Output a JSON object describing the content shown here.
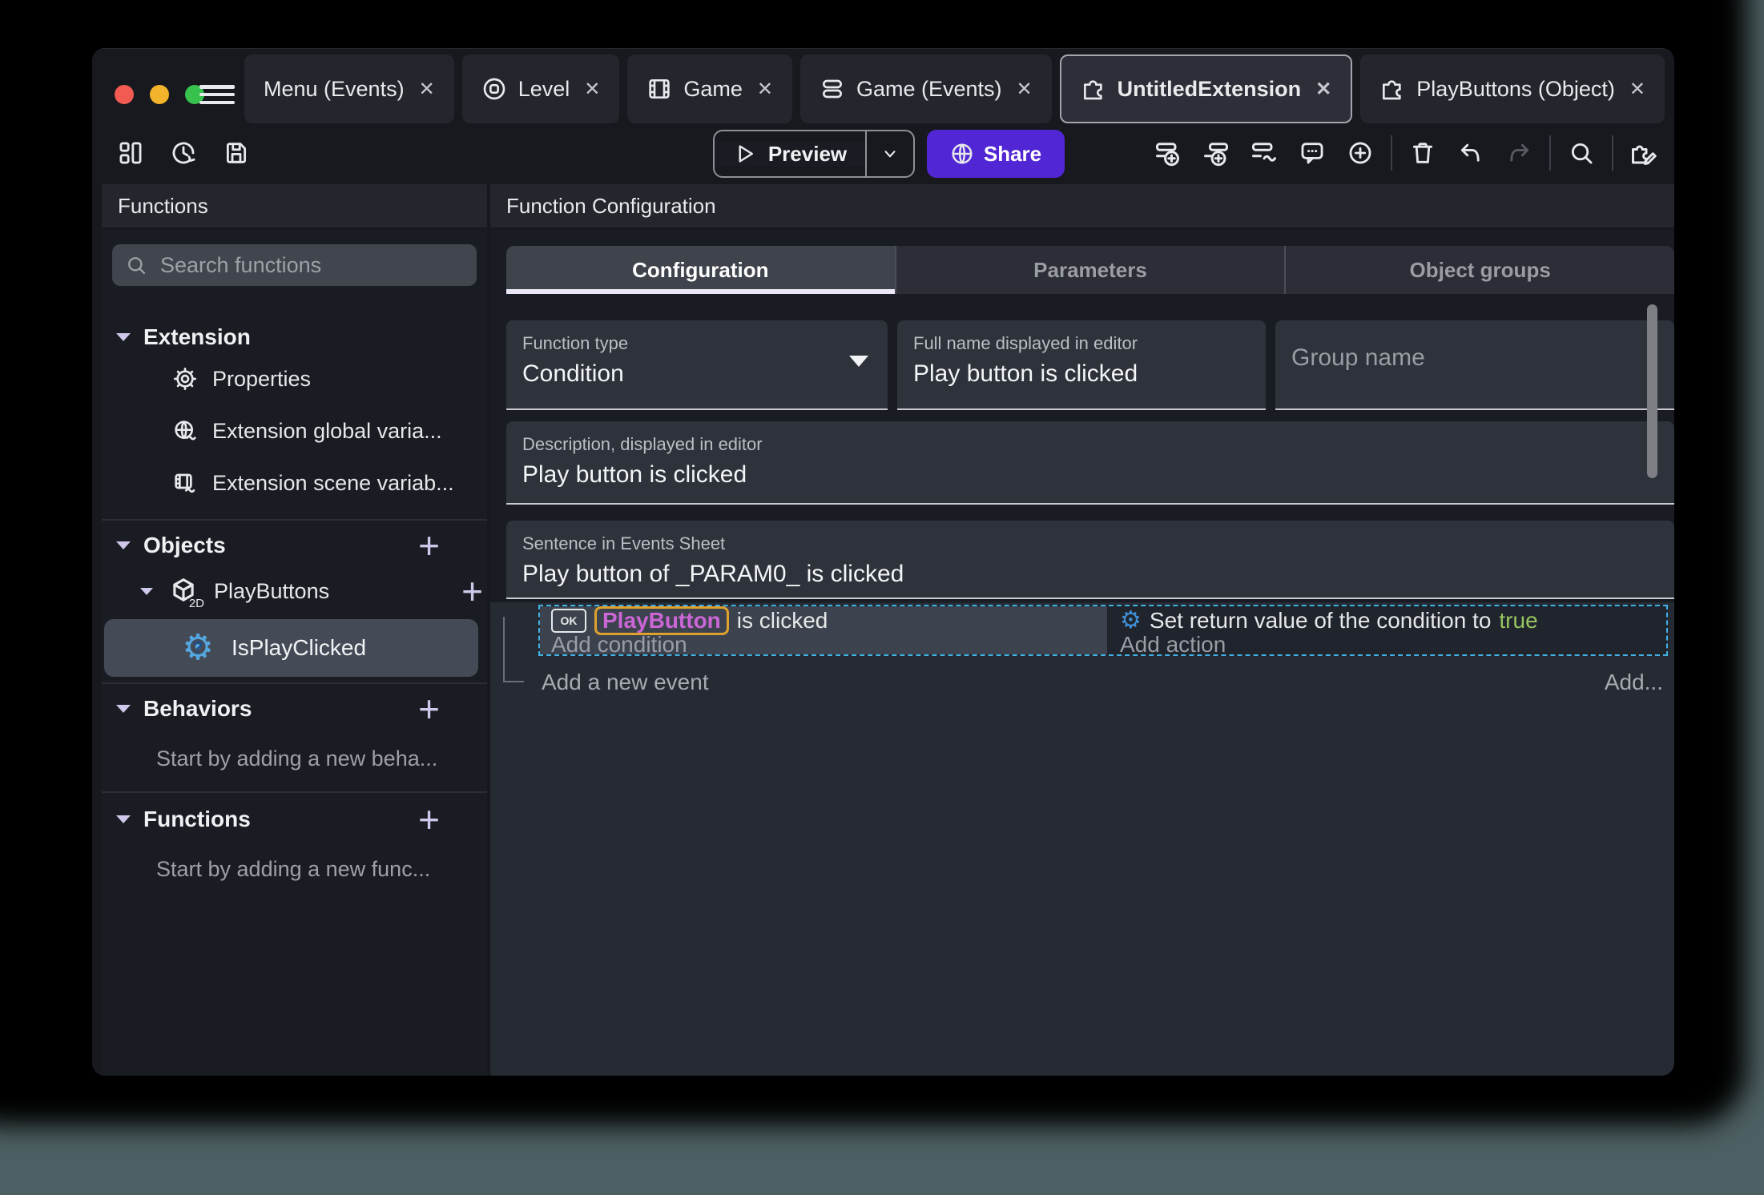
{
  "tabbar": {
    "close_glyph": "✕",
    "tabs": [
      {
        "label": "Menu (Events)"
      },
      {
        "label": "Level"
      },
      {
        "label": "Game"
      },
      {
        "label": "Game (Events)"
      },
      {
        "label": "UntitledExtension"
      },
      {
        "label": "PlayButtons (Object)"
      }
    ]
  },
  "toolbar": {
    "preview_label": "Preview",
    "share_label": "Share"
  },
  "sidebar": {
    "title": "Functions",
    "search_placeholder": "Search functions",
    "plus_glyph": "+",
    "extension": {
      "label": "Extension",
      "items": [
        "Properties",
        "Extension global varia...",
        "Extension scene variab..."
      ]
    },
    "objects": {
      "label": "Objects",
      "object_label": "PlayButtons",
      "badge_2d": "2D",
      "function_label": "IsPlayClicked"
    },
    "behaviors": {
      "label": "Behaviors",
      "empty": "Start by adding a new beha..."
    },
    "functions": {
      "label": "Functions",
      "empty": "Start by adding a new func..."
    }
  },
  "main": {
    "title": "Function Configuration",
    "tabs": [
      "Configuration",
      "Parameters",
      "Object groups"
    ],
    "fields": {
      "function_type": {
        "label": "Function type",
        "value": "Condition"
      },
      "full_name": {
        "label": "Full name displayed in editor",
        "value": "Play button is clicked"
      },
      "group_name": {
        "placeholder": "Group name"
      },
      "description": {
        "label": "Description, displayed in editor",
        "value": "Play button is clicked"
      },
      "sentence": {
        "label": "Sentence in Events Sheet",
        "value": "Play button of _PARAM0_ is clicked"
      }
    },
    "events": {
      "condition": {
        "icon_label": "OK",
        "object": "PlayButton",
        "text": "is clicked",
        "add": "Add condition"
      },
      "action": {
        "text_prefix": "Set return value of the condition to",
        "value": "true",
        "add": "Add action"
      },
      "add_new_event": "Add a new event",
      "add_more": "Add..."
    }
  },
  "colors": {
    "accent_purple": "#5126d4",
    "object_chip_text": "#cb66d6",
    "chip_highlight_border": "#dfa12e",
    "true_green": "#97c55f",
    "selection_dashed": "#41b1e4",
    "selected_row": "#454b56",
    "traffic_red": "#f25b51",
    "traffic_yellow": "#f3b32a",
    "traffic_green": "#36c24c"
  }
}
